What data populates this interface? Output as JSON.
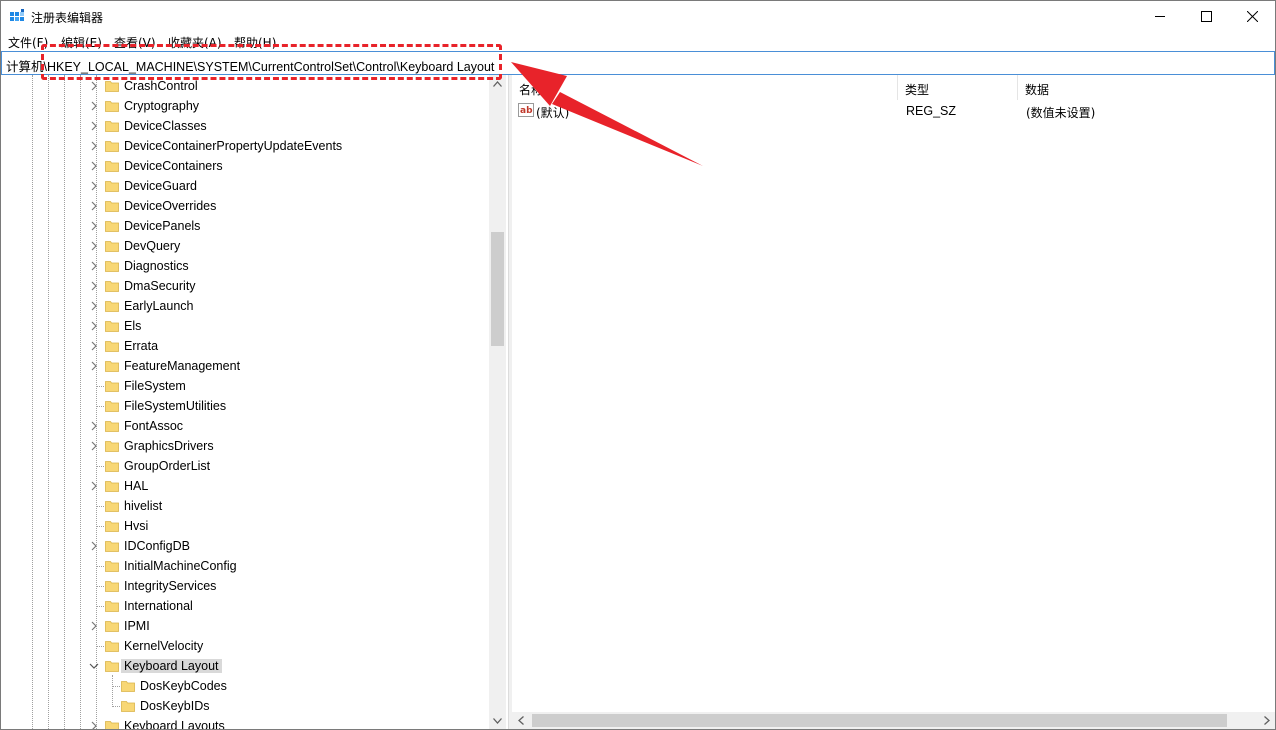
{
  "window": {
    "title": "注册表编辑器"
  },
  "menu": [
    "文件(F)",
    "编辑(E)",
    "查看(V)",
    "收藏夹(A)",
    "帮助(H)"
  ],
  "address": "计算机\\HKEY_LOCAL_MACHINE\\SYSTEM\\CurrentControlSet\\Control\\Keyboard Layout",
  "tree": {
    "items": [
      "CrashControl",
      "Cryptography",
      "DeviceClasses",
      "DeviceContainerPropertyUpdateEvents",
      "DeviceContainers",
      "DeviceGuard",
      "DeviceOverrides",
      "DevicePanels",
      "DevQuery",
      "Diagnostics",
      "DmaSecurity",
      "EarlyLaunch",
      "Els",
      "Errata",
      "FeatureManagement",
      "FileSystem",
      "FileSystemUtilities",
      "FontAssoc",
      "GraphicsDrivers",
      "GroupOrderList",
      "HAL",
      "hivelist",
      "Hvsi",
      "IDConfigDB",
      "InitialMachineConfig",
      "IntegrityServices",
      "International",
      "IPMI",
      "KernelVelocity",
      "Keyboard Layout"
    ],
    "expandable": [
      true,
      true,
      true,
      true,
      true,
      true,
      true,
      true,
      true,
      true,
      true,
      true,
      true,
      true,
      true,
      false,
      false,
      true,
      true,
      false,
      true,
      false,
      false,
      true,
      false,
      false,
      false,
      true,
      false,
      true
    ],
    "children": [
      "DosKeybCodes",
      "DosKeybIDs"
    ],
    "next_item": "Keyboard Layouts"
  },
  "columns": {
    "name": "名称",
    "type": "类型",
    "data": "数据"
  },
  "values": [
    {
      "name": "(默认)",
      "type": "REG_SZ",
      "data": "(数值未设置)"
    }
  ],
  "colors": {
    "annotation": "#e8232a",
    "selection": "#d9d9d9",
    "address_border": "#4a8fd7"
  }
}
